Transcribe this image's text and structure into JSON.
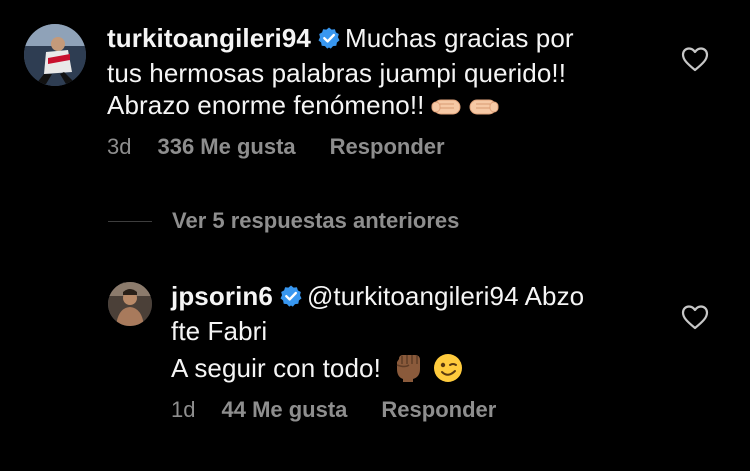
{
  "comment": {
    "username": "turkitoangileri94",
    "text_line1": "Muchas gracias por",
    "text_line2": "tus hermosas palabras juampi querido!!",
    "text_line3": "Abrazo enorme fenómeno!!",
    "time": "3d",
    "likes": "336 Me gusta",
    "reply": "Responder"
  },
  "view_replies": {
    "label": "Ver 5 respuestas anteriores"
  },
  "reply_comment": {
    "username": "jpsorin6",
    "mention": "@turkitoangileri94",
    "text_line1_rest": "Abzo",
    "text_line2": "fte Fabri",
    "text_line3": "A seguir con todo!",
    "time": "1d",
    "likes": "44 Me gusta",
    "reply": "Responder"
  },
  "colors": {
    "background": "#000000",
    "text": "#f5f5f5",
    "secondary": "#8e8e8e",
    "verified": "#3897f0"
  },
  "icons": {
    "verified": "verified-badge-icon",
    "like": "heart-outline-icon",
    "fist_bump": "fist-bump-emoji",
    "raised_fist": "raised-fist-emoji",
    "wink": "winking-face-emoji"
  }
}
